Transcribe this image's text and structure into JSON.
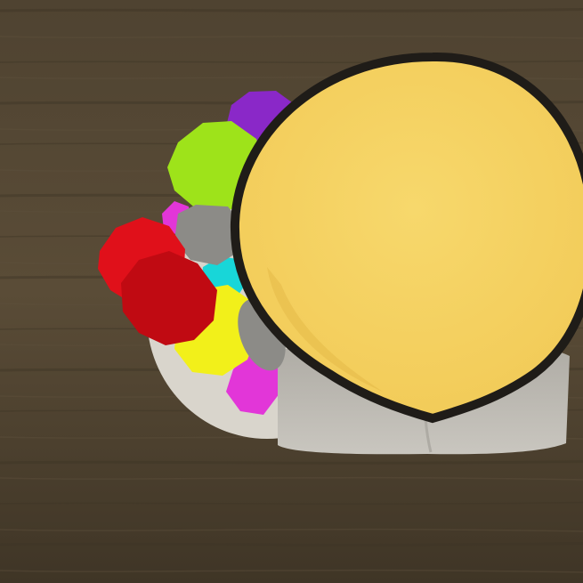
{
  "scene": {
    "description_name": "game-item-render",
    "colors": {
      "background": "#4f4331",
      "background_dark": "#3f3526",
      "background_light": "#5e503b",
      "plate": "#d9d5cc",
      "plate_shadow": "#b9b5ac",
      "head_fill": "#f2cb58",
      "head_highlight": "#f7d86c",
      "head_outline": "#1f1c18",
      "cloth": "#c9c6bf",
      "cloth_shadow": "#aeaba4",
      "grey_piece": "#8c8b87",
      "gem_purple": "#8a28c8",
      "gem_lime": "#9ee31a",
      "gem_red": "#e0101a",
      "gem_red_dark": "#c00a12",
      "gem_yellow": "#f2f01a",
      "gem_cyan": "#18d6d8",
      "gem_magenta": "#e236d8"
    },
    "icons": [
      "yellow-sphere-icon",
      "gem-purple-icon",
      "gem-lime-icon",
      "gem-red-icon",
      "gem-yellow-icon",
      "gem-cyan-icon",
      "gem-magenta-icon",
      "cloth-wrap-icon",
      "plate-icon"
    ]
  }
}
